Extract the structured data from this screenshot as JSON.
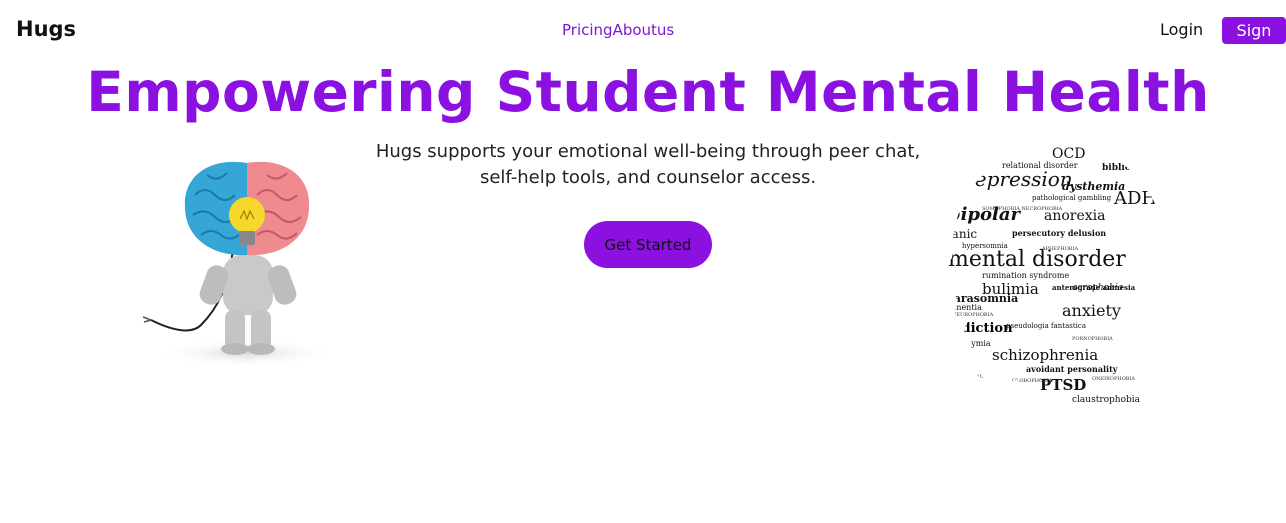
{
  "nav": {
    "brand": "Hugs",
    "links": [
      "Pricing",
      "Aboutus"
    ],
    "login": "Login",
    "signup": "Sign Up"
  },
  "hero": {
    "title": "Empowering Student Mental Health",
    "subtitle_line1": "Hugs supports your emotional well-being through peer chat,",
    "subtitle_line2": "self-help tools, and counselor access.",
    "cta": "Get Started"
  },
  "images": {
    "left": "brain-lightbulb-figure",
    "right": "mental-health-word-cloud-head"
  },
  "word_cloud": {
    "words": [
      "OCD",
      "depression",
      "bibliomania",
      "dysthemia",
      "ADHD",
      "bipolar",
      "anorexia",
      "panic",
      "persecutory delusion",
      "mental disorder",
      "bulimia",
      "parasomnia",
      "anterograde amnesia",
      "anxiety",
      "addiction",
      "schizophrenia",
      "avoidant personality",
      "PTSD",
      "claustrophobia",
      "acrophobia",
      "dementia"
    ]
  },
  "colors": {
    "brand_purple": "#8b11e0",
    "link_purple": "#7c17d6"
  }
}
